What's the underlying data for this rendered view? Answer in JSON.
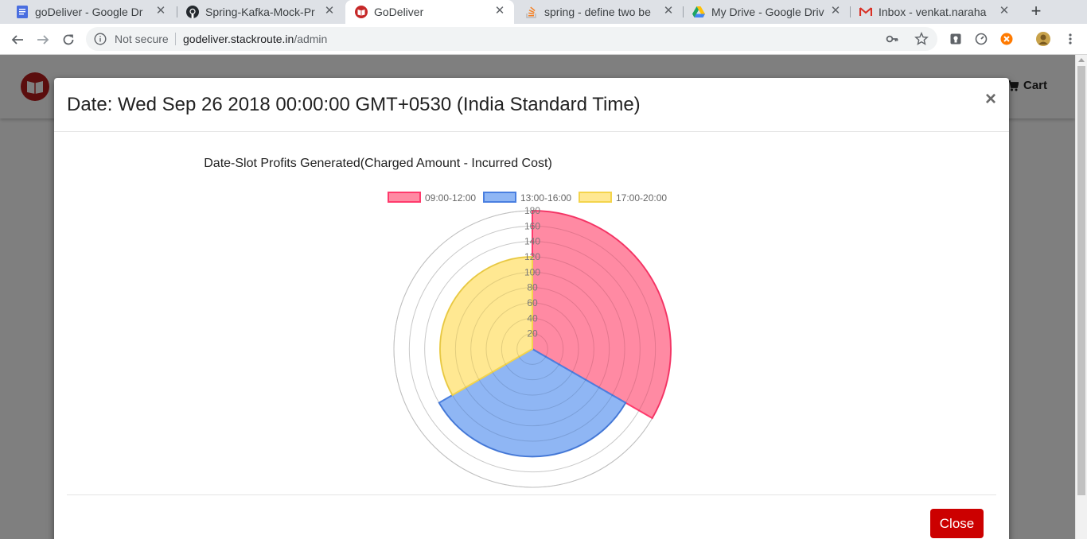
{
  "browser": {
    "tabs": [
      {
        "title": "goDeliver - Google Dr",
        "icon": "google-docs-icon",
        "active": false
      },
      {
        "title": "Spring-Kafka-Mock-Pr",
        "icon": "github-icon",
        "active": false
      },
      {
        "title": "GoDeliver",
        "icon": "godeliver-icon",
        "active": true
      },
      {
        "title": "spring - define two be",
        "icon": "stackoverflow-icon",
        "active": false
      },
      {
        "title": "My Drive - Google Driv",
        "icon": "google-drive-icon",
        "active": false
      },
      {
        "title": "Inbox - venkat.naraha",
        "icon": "gmail-icon",
        "active": false
      }
    ],
    "security_label": "Not secure",
    "url_host": "godeliver.stackroute.in",
    "url_path": "/admin"
  },
  "app": {
    "cart_label": "Cart"
  },
  "modal": {
    "title": "Date: Wed Sep 26 2018 00:00:00 GMT+0530 (India Standard Time)",
    "close_label": "Close",
    "close_x": "×"
  },
  "chart_data": {
    "type": "polarArea",
    "title": "Date-Slot Profits Generated(Charged Amount - Incurred Cost)",
    "categories": [
      "09:00-12:00",
      "13:00-16:00",
      "17:00-20:00"
    ],
    "values": [
      180,
      140,
      120
    ],
    "colors": [
      "#ff6384",
      "#6a9ef0",
      "#ffe06e"
    ],
    "border_colors": [
      "#ff3a6c",
      "#4a7fe0",
      "#f4d44c"
    ],
    "r_ticks": [
      20,
      40,
      60,
      80,
      100,
      120,
      140,
      160,
      180
    ],
    "r_max": 180,
    "legend_position": "top"
  }
}
